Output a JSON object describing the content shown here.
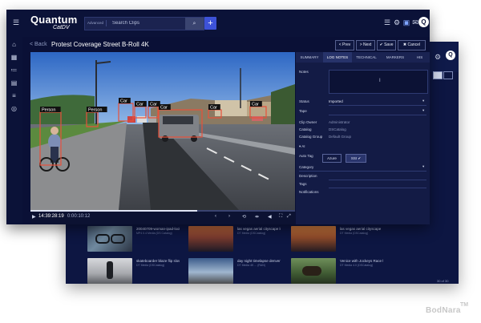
{
  "header": {
    "logo_main": "Quantum",
    "logo_sub": "CatDV",
    "search": {
      "advanced_label": "Advanced",
      "placeholder": "Search Clips"
    },
    "add_label": "+",
    "user_initial": "Q"
  },
  "clip": {
    "back_label": "< Back",
    "title": "Protest Coverage Street B-Roll 4K"
  },
  "toolbar": {
    "prev_label": "< Prev",
    "next_label": "> Next",
    "save_label": "✔ Save",
    "cancel_label": "✖ Cancel"
  },
  "player": {
    "timecode": "14:39:28:19",
    "duration": "0:00:10:12",
    "progress_fraction": 0.63,
    "detections": [
      {
        "label": "Person"
      },
      {
        "label": "Person"
      },
      {
        "label": "Car"
      },
      {
        "label": "Car"
      },
      {
        "label": "Car"
      },
      {
        "label": "Car"
      },
      {
        "label": "Car"
      },
      {
        "label": "Car"
      }
    ]
  },
  "panel": {
    "tabs": [
      {
        "label": "SUMMARY"
      },
      {
        "label": "LOG NOTES"
      },
      {
        "label": "TECHNICAL"
      },
      {
        "label": "MARKERS"
      },
      {
        "label": "HIS"
      }
    ],
    "active_tab": 1,
    "notes_label": "Notes",
    "fields": {
      "status_label": "Status",
      "status_value": "Imported",
      "tape_label": "Tape",
      "clip_owner_label": "Clip Owner",
      "clip_owner_value": "Administrator",
      "catalog_label": "Catalog",
      "catalog_value": "DSCatalog",
      "catalog_group_label": "Catalog Group",
      "catalog_group_value": "Default Group"
    },
    "ai_label": "AI",
    "auto_tag_label": "Auto Tag",
    "auto_tag_options": [
      "Azure",
      "SSI ✔"
    ],
    "category_label": "Category",
    "description_label": "Description",
    "tags_label": "Tags",
    "notifications_label": "Notifications"
  },
  "grid": {
    "items": [
      {
        "title": "20040709-woman-ipad-looking",
        "sub": "MP4 0.4 Media (DS Catalog)"
      },
      {
        "title": "las vegas aerial cityscape lot 1",
        "sub": "DT Media (DSCatalog)"
      },
      {
        "title": "las vegas aerial cityscape",
        "sub": "DT Media (DSCatalog)"
      },
      {
        "title": "skateboarder blaze flip slow mo",
        "sub": "DT Media (DSCatalog)"
      },
      {
        "title": "day night timelapse denver",
        "sub": "DT Media 4K ... (RAN)"
      },
      {
        "title": "Venice with Jockeys Race flying",
        "sub": "DT Media 4.0 (DSCatalog)"
      }
    ],
    "page_info": "30 of 30"
  },
  "watermark": {
    "main": "BodNara",
    "badge": "TM"
  }
}
